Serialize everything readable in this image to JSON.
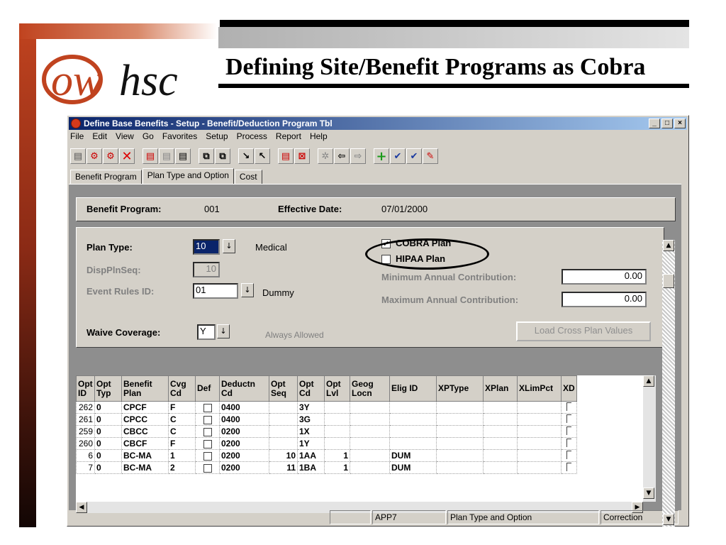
{
  "slide": {
    "title": "Defining Site/Benefit Programs as Cobra",
    "logo_text": "owhsc"
  },
  "window": {
    "title": "Define Base Benefits - Setup - Benefit/Deduction Program Tbl",
    "menu": [
      "File",
      "Edit",
      "View",
      "Go",
      "Favorites",
      "Setup",
      "Process",
      "Report",
      "Help"
    ],
    "toolbar_icons": [
      "save-icon",
      "next-in-list-icon",
      "return-to-list-icon",
      "delete-icon",
      "insert-row-icon",
      "delete-row-icon",
      "view-all-icon",
      "update-icon",
      "update-all-icon",
      "next-page-icon",
      "prev-page-icon",
      "panel-help-icon",
      "field-help-icon",
      "settings-icon",
      "back-icon",
      "forward-icon",
      "add-icon",
      "check-icon",
      "check-all-icon",
      "edit-icon"
    ],
    "tabs": [
      "Benefit Program",
      "Plan Type and Option",
      "Cost"
    ]
  },
  "header": {
    "benefit_program_label": "Benefit Program:",
    "benefit_program_value": "001",
    "effective_date_label": "Effective Date:",
    "effective_date_value": "07/01/2000"
  },
  "plan": {
    "plan_type_label": "Plan Type:",
    "plan_type_value": "10",
    "plan_type_desc": "Medical",
    "disp_label": "DispPlnSeq:",
    "disp_value": "10",
    "event_label": "Event Rules ID:",
    "event_value": "01",
    "event_desc": "Dummy",
    "waive_label": "Waive Coverage:",
    "waive_value": "Y",
    "waive_desc": "Always Allowed",
    "cobra_label": "COBRA Plan",
    "hipaa_label": "HIPAA Plan",
    "min_label": "Minimum Annual Contribution:",
    "min_value": "0.00",
    "max_label": "Maximum Annual Contribution:",
    "max_value": "0.00",
    "load_button": "Load Cross Plan Values"
  },
  "grid": {
    "columns": [
      "Opt ID",
      "Opt Typ",
      "Benefit Plan",
      "Cvg Cd",
      "Def",
      "Deductn Cd",
      "Opt Seq",
      "Opt Cd",
      "Opt Lvl",
      "Geog Locn",
      "Elig ID",
      "XPType",
      "XPlan",
      "XLimPct",
      "XD"
    ],
    "rows": [
      [
        "262",
        "0",
        "CPCF",
        "F",
        "",
        "0400",
        "",
        "3Y",
        "",
        "",
        "",
        "",
        "",
        "",
        ""
      ],
      [
        "261",
        "0",
        "CPCC",
        "C",
        "",
        "0400",
        "",
        "3G",
        "",
        "",
        "",
        "",
        "",
        "",
        ""
      ],
      [
        "259",
        "0",
        "CBCC",
        "C",
        "",
        "0200",
        "",
        "1X",
        "",
        "",
        "",
        "",
        "",
        "",
        ""
      ],
      [
        "260",
        "0",
        "CBCF",
        "F",
        "",
        "0200",
        "",
        "1Y",
        "",
        "",
        "",
        "",
        "",
        "",
        ""
      ],
      [
        "6",
        "0",
        "BC-MA",
        "1",
        "",
        "0200",
        "10",
        "1AA",
        "1",
        "",
        "DUM",
        "",
        "",
        "",
        ""
      ],
      [
        "7",
        "0",
        "BC-MA",
        "2",
        "",
        "0200",
        "11",
        "1BA",
        "1",
        "",
        "DUM",
        "",
        "",
        "",
        ""
      ]
    ]
  },
  "status": {
    "app": "APP7",
    "panel": "Plan Type and Option",
    "mode": "Correction"
  }
}
